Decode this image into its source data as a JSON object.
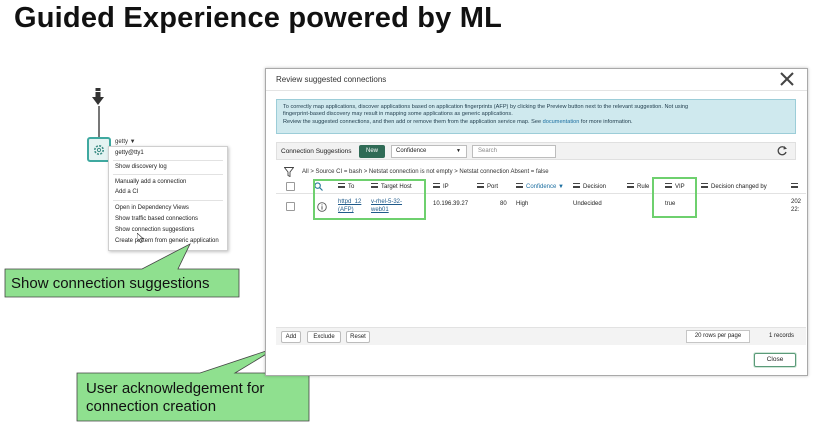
{
  "slide": {
    "title": "Guided Experience powered by ML"
  },
  "node": {
    "label": "getty ▼"
  },
  "context_menu": {
    "items": [
      "getty@tty1",
      "Show discovery log",
      "Manually add a connection",
      "Add a CI",
      "Open in Dependency Views",
      "Show traffic based connections",
      "Show connection suggestions",
      "Create pattern from generic application"
    ]
  },
  "callouts": {
    "show_suggestions": "Show connection suggestions",
    "acknowledgement_line1": "User acknowledgement for",
    "acknowledgement_line2": "connection creation"
  },
  "dialog": {
    "title": "Review suggested connections",
    "info_line1": "To correctly map applications, discover applications based on application fingerprints (AFP) by clicking the Preview button next to the relevant suggestion. Not using",
    "info_line2": "fingerprint-based discovery may result in mapping some applications as generic applications.",
    "info_line3_pre": "Review the suggested connections, and then add or remove them from the application service map. See",
    "info_link": "documentation",
    "info_line3_post": "for more information.",
    "toolbar": {
      "label": "Connection Suggestions",
      "new_button": "New",
      "select_value": "Confidence",
      "search_placeholder": "Search"
    },
    "breadcrumb": "All  >  Source CI = bash  >  Netstat connection is not empty  >  Netstat connection Absent = false",
    "columns": {
      "to": "To",
      "target_host": "Target Host",
      "ip": "IP",
      "port": "Port",
      "confidence": "Confidence ▼",
      "decision": "Decision",
      "rule": "Rule",
      "vip": "VIP",
      "decision_changed_by": "Decision changed by"
    },
    "row": {
      "to_line1": "httpd_12",
      "to_line2": "(AFP)",
      "target_line1": "v-rhel-5-32-",
      "target_line2": "web01",
      "ip": "10.196.39.27",
      "port": "80",
      "confidence": "High",
      "decision": "Undecided",
      "vip": "true",
      "changed_line1": "202",
      "changed_line2": "22:"
    },
    "footer": {
      "add": "Add",
      "exclude": "Exclude",
      "reset": "Reset",
      "rows_per_page": "20 rows per page",
      "records": "1 records"
    },
    "close_button": "Close"
  },
  "colors": {
    "highlight_green": "#6ed06e",
    "callout_fill": "#8fe08f",
    "new_button": "#2f6b56",
    "info_bg": "#cfe9ee"
  }
}
